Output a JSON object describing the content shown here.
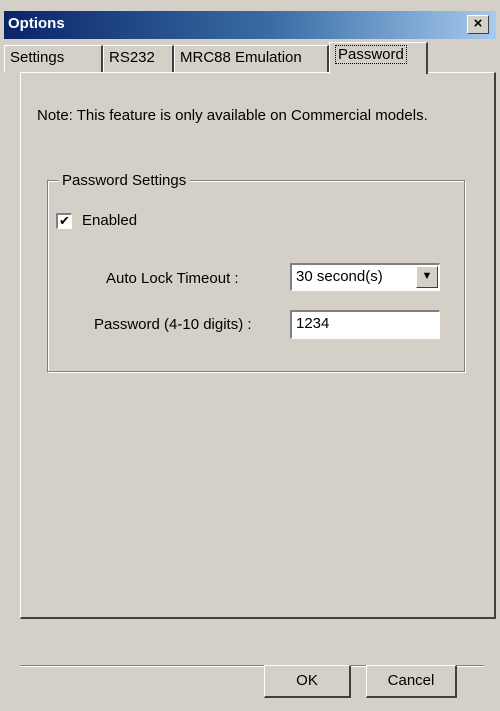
{
  "window": {
    "title": "Options",
    "close_glyph": "×"
  },
  "tabs": [
    {
      "label": "Settings",
      "active": false
    },
    {
      "label": "RS232",
      "active": false
    },
    {
      "label": "MRC88 Emulation",
      "active": false
    },
    {
      "label": "Password",
      "active": true
    }
  ],
  "note": "Note: This feature is only available on Commercial models.",
  "group": {
    "title": "Password Settings",
    "enabled": {
      "label": "Enabled",
      "checked": true,
      "check_glyph": "✔"
    },
    "auto_lock": {
      "label": "Auto Lock Timeout :",
      "value": "30 second(s)",
      "arrow_icon": "chevron-down-icon"
    },
    "password": {
      "label": "Password (4-10 digits) :",
      "value": "1234"
    }
  },
  "buttons": {
    "ok": "OK",
    "cancel": "Cancel"
  }
}
